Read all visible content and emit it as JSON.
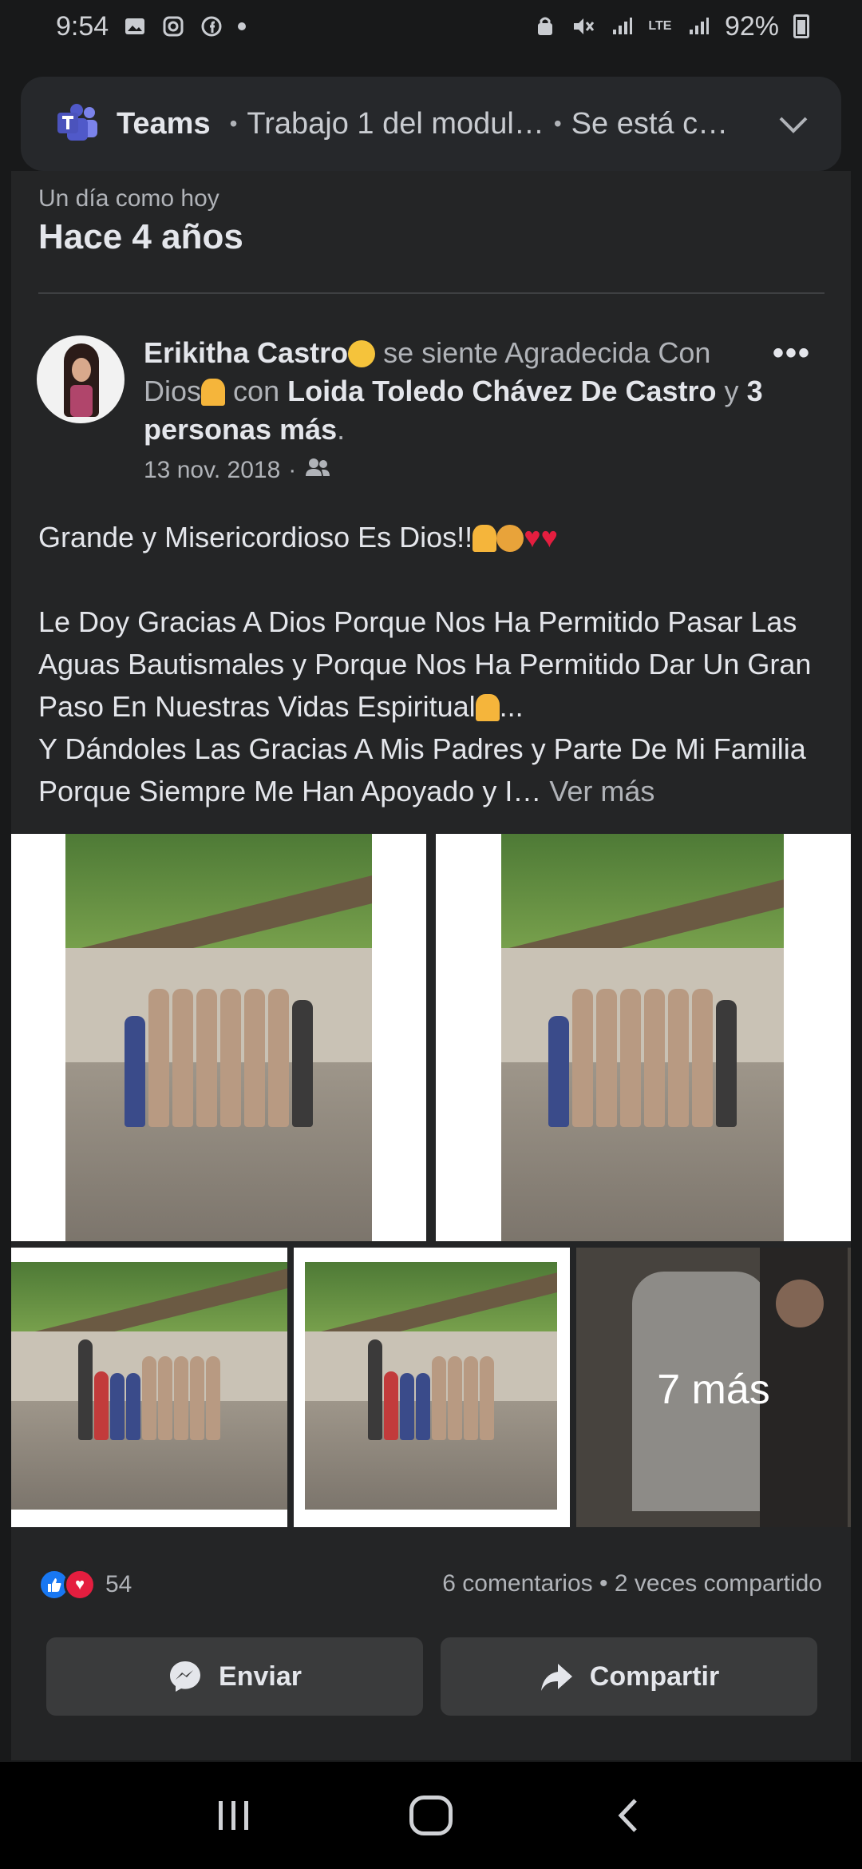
{
  "status_bar": {
    "time": "9:54",
    "battery": "92%",
    "left_icons": [
      "gallery-icon",
      "instagram-icon",
      "facebook-icon"
    ],
    "right_icons": [
      "alarm-icon",
      "mute-icon",
      "signal-icon",
      "lte-icon",
      "signal-icon",
      "battery-icon"
    ]
  },
  "notification": {
    "app": "Teams",
    "title": "Trabajo 1 del modul…",
    "subtitle": "Se está c…"
  },
  "memory": {
    "kicker": "Un día como hoy",
    "title": "Hace 4 años"
  },
  "post": {
    "author": "Erikitha Castro",
    "feeling_text": "se siente Agradecida Con Dios",
    "with_word": "con",
    "tagged": "Loida Toledo Chávez De Castro",
    "and_word": "y",
    "others": "3 personas más",
    "date": "13 nov. 2018",
    "audience_icon": "friends-icon",
    "body_line1": "Grande y Misericordioso Es Dios!!",
    "body_para2": "Le Doy Gracias A Dios Porque Nos Ha Permitido Pasar Las Aguas Bautismales y Porque Nos Ha Permitido Dar Un Gran Paso En Nuestras Vidas Espiritual",
    "body_para2_ellipsis": "...",
    "body_para3": "Y Dándoles Las Gracias A Mis Padres y Parte De Mi Familia Porque Siempre Me Han Apoyado y I…",
    "see_more": "Ver más",
    "more_photos": "7 más"
  },
  "engagement": {
    "reaction_count": "54",
    "comments": "6 comentarios",
    "shares": "2 veces compartido",
    "colors": {
      "like": "#1877f2",
      "love": "#e41e3f"
    }
  },
  "actions": {
    "send_label": "Enviar",
    "share_label": "Compartir"
  }
}
